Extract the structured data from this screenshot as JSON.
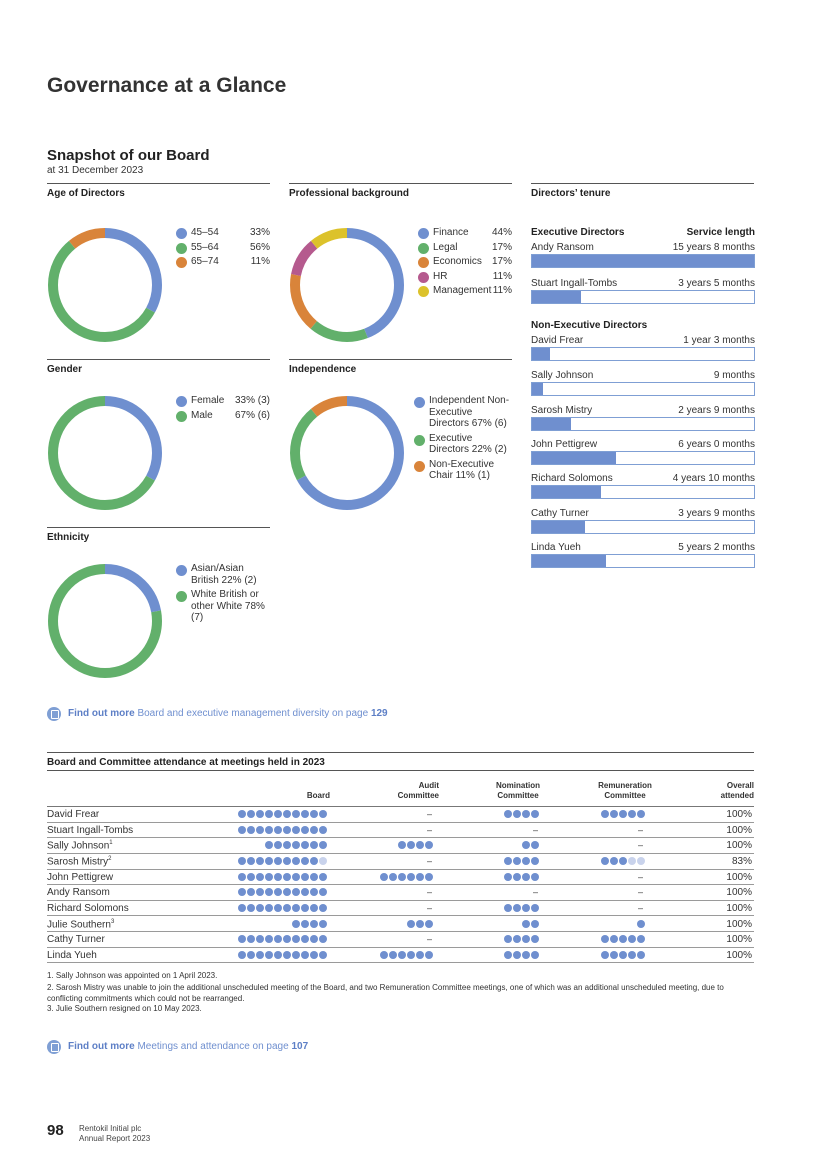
{
  "page": {
    "title": "Governance at a Glance",
    "number": "98",
    "footer_company": "Rentokil Initial plc",
    "footer_report": "Annual Report 2023"
  },
  "snapshot": {
    "title": "Snapshot of our Board",
    "subtitle": "at 31 December 2023"
  },
  "colors": {
    "blue": "#6f8fcf",
    "green": "#62b06b",
    "orange": "#d9843a",
    "magenta": "#b55a8e",
    "yellow": "#dcc22b"
  },
  "charts": {
    "age": {
      "title": "Age of Directors",
      "items": [
        {
          "label": "45–54",
          "value": "33%",
          "pct": 33,
          "color": "#6f8fcf"
        },
        {
          "label": "55–64",
          "value": "56%",
          "pct": 56,
          "color": "#62b06b"
        },
        {
          "label": "65–74",
          "value": "11%",
          "pct": 11,
          "color": "#d9843a"
        }
      ]
    },
    "professional": {
      "title": "Professional background",
      "items": [
        {
          "label": "Finance",
          "value": "44%",
          "pct": 44,
          "color": "#6f8fcf"
        },
        {
          "label": "Legal",
          "value": "17%",
          "pct": 17,
          "color": "#62b06b"
        },
        {
          "label": "Economics",
          "value": "17%",
          "pct": 17,
          "color": "#d9843a"
        },
        {
          "label": "HR",
          "value": "11%",
          "pct": 11,
          "color": "#b55a8e"
        },
        {
          "label": "Management",
          "value": "11%",
          "pct": 11,
          "color": "#dcc22b"
        }
      ]
    },
    "gender": {
      "title": "Gender",
      "items": [
        {
          "label": "Female",
          "value": "33% (3)",
          "pct": 33,
          "color": "#6f8fcf"
        },
        {
          "label": "Male",
          "value": "67% (6)",
          "pct": 67,
          "color": "#62b06b"
        }
      ]
    },
    "independence": {
      "title": "Independence",
      "items": [
        {
          "label": "Independent Non-Executive Directors 67% (6)",
          "pct": 67,
          "color": "#6f8fcf"
        },
        {
          "label": "Executive Directors 22% (2)",
          "pct": 22,
          "color": "#62b06b"
        },
        {
          "label": "Non-Executive Chair 11% (1)",
          "pct": 11,
          "color": "#d9843a"
        }
      ]
    },
    "ethnicity": {
      "title": "Ethnicity",
      "items": [
        {
          "label": "Asian/Asian British 22% (2)",
          "pct": 22,
          "color": "#6f8fcf"
        },
        {
          "label": "White British or other White 78% (7)",
          "pct": 78,
          "color": "#62b06b"
        }
      ]
    }
  },
  "tenure": {
    "title": "Directors’ tenure",
    "exec_heading": "Executive Directors",
    "service_heading": "Service length",
    "nonexec_heading": "Non-Executive Directors",
    "executives": [
      {
        "name": "Andy Ransom",
        "length": "15 years 8 months",
        "fraction": 1.0
      },
      {
        "name": "Stuart Ingall-Tombs",
        "length": "3 years 5 months",
        "fraction": 0.22
      }
    ],
    "non_executives": [
      {
        "name": "David Frear",
        "length": "1 year 3 months",
        "fraction": 0.08
      },
      {
        "name": "Sally Johnson",
        "length": "9 months",
        "fraction": 0.05
      },
      {
        "name": "Sarosh Mistry",
        "length": "2 years 9 months",
        "fraction": 0.175
      },
      {
        "name": "John Pettigrew",
        "length": "6 years 0 months",
        "fraction": 0.38
      },
      {
        "name": "Richard Solomons",
        "length": "4 years 10 months",
        "fraction": 0.31
      },
      {
        "name": "Cathy Turner",
        "length": "3 years 9 months",
        "fraction": 0.24
      },
      {
        "name": "Linda Yueh",
        "length": "5 years 2 months",
        "fraction": 0.335
      }
    ]
  },
  "find_more_1": {
    "bold": "Find out more",
    "text": " Board and executive management diversity on page ",
    "page": "129"
  },
  "attendance": {
    "title": "Board and Committee attendance at meetings held in 2023",
    "headers": {
      "board": "Board",
      "audit": "Audit Committee",
      "nomination": "Nomination Committee",
      "remuneration": "Remuneration Committee",
      "overall": "Overall attended"
    },
    "rows": [
      {
        "name": "David Frear",
        "sup": "",
        "board": [
          10,
          10
        ],
        "audit": null,
        "nomination": [
          4,
          4
        ],
        "remuneration": [
          5,
          5
        ],
        "overall": "100%"
      },
      {
        "name": "Stuart Ingall-Tombs",
        "sup": "",
        "board": [
          10,
          10
        ],
        "audit": null,
        "nomination": null,
        "remuneration": null,
        "overall": "100%"
      },
      {
        "name": "Sally Johnson",
        "sup": "1",
        "board": [
          7,
          7
        ],
        "audit": [
          4,
          4
        ],
        "nomination": [
          2,
          2
        ],
        "remuneration": null,
        "overall": "100%"
      },
      {
        "name": "Sarosh Mistry",
        "sup": "2",
        "board": [
          9,
          10
        ],
        "audit": null,
        "nomination": [
          4,
          4
        ],
        "remuneration": [
          3,
          5
        ],
        "overall": "83%"
      },
      {
        "name": "John Pettigrew",
        "sup": "",
        "board": [
          10,
          10
        ],
        "audit": [
          6,
          6
        ],
        "nomination": [
          4,
          4
        ],
        "remuneration": null,
        "overall": "100%"
      },
      {
        "name": "Andy Ransom",
        "sup": "",
        "board": [
          10,
          10
        ],
        "audit": null,
        "nomination": null,
        "remuneration": null,
        "overall": "100%"
      },
      {
        "name": "Richard Solomons",
        "sup": "",
        "board": [
          10,
          10
        ],
        "audit": null,
        "nomination": [
          4,
          4
        ],
        "remuneration": null,
        "overall": "100%"
      },
      {
        "name": "Julie Southern",
        "sup": "3",
        "board": [
          4,
          4
        ],
        "audit": [
          3,
          3
        ],
        "nomination": [
          2,
          2
        ],
        "remuneration": [
          1,
          1
        ],
        "overall": "100%"
      },
      {
        "name": "Cathy Turner",
        "sup": "",
        "board": [
          10,
          10
        ],
        "audit": null,
        "nomination": [
          4,
          4
        ],
        "remuneration": [
          5,
          5
        ],
        "overall": "100%"
      },
      {
        "name": "Linda Yueh",
        "sup": "",
        "board": [
          10,
          10
        ],
        "audit": [
          6,
          6
        ],
        "nomination": [
          4,
          4
        ],
        "remuneration": [
          5,
          5
        ],
        "overall": "100%"
      }
    ],
    "dash": "–",
    "footnotes": [
      "1. Sally Johnson was appointed on 1 April 2023.",
      "2. Sarosh Mistry was unable to join the additional unscheduled meeting of the Board, and two Remuneration Committee meetings, one of which was an additional unscheduled meeting, due to conflicting commitments which could not be rearranged.",
      "3. Julie Southern resigned on 10 May 2023."
    ]
  },
  "find_more_2": {
    "bold": "Find out more",
    "text": " Meetings and attendance on page ",
    "page": "107"
  }
}
